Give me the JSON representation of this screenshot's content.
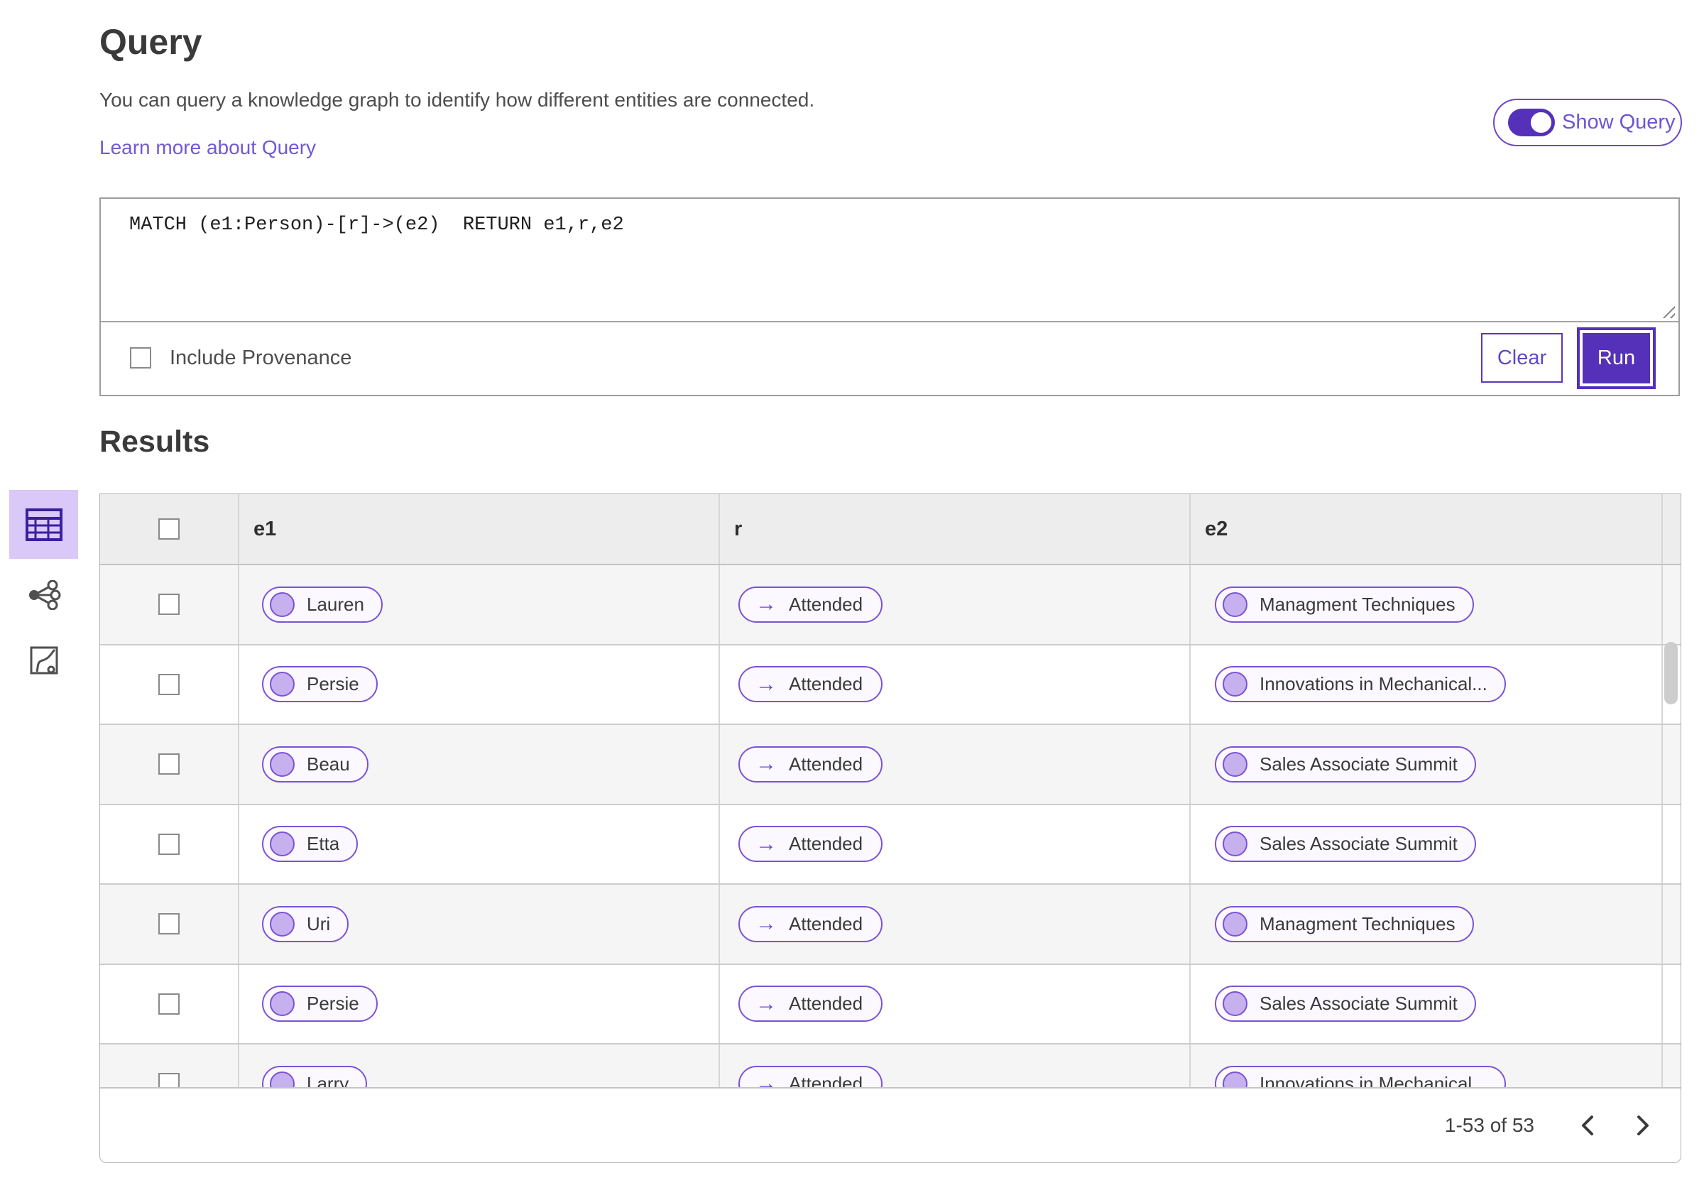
{
  "page": {
    "title": "Query",
    "description": "You can query a knowledge graph to identify how different entities are connected.",
    "learn_more_link": "Learn more about Query"
  },
  "show_query_toggle": {
    "label": "Show Query",
    "state": "on"
  },
  "query_editor": {
    "query_text": "MATCH (e1:Person)-[r]->(e2)  RETURN e1,r,e2",
    "include_provenance_label": "Include Provenance",
    "include_provenance_checked": false,
    "clear_label": "Clear",
    "run_label": "Run"
  },
  "results": {
    "title": "Results",
    "columns": {
      "e1": "e1",
      "r": "r",
      "e2": "e2"
    },
    "rows": [
      {
        "e1": "Lauren",
        "r": "Attended",
        "e2": "Managment Techniques"
      },
      {
        "e1": "Persie",
        "r": "Attended",
        "e2": "Innovations in Mechanical..."
      },
      {
        "e1": "Beau",
        "r": "Attended",
        "e2": "Sales Associate Summit"
      },
      {
        "e1": "Etta",
        "r": "Attended",
        "e2": "Sales Associate Summit"
      },
      {
        "e1": "Uri",
        "r": "Attended",
        "e2": "Managment Techniques"
      },
      {
        "e1": "Persie",
        "r": "Attended",
        "e2": "Sales Associate Summit"
      },
      {
        "e1": "Larry",
        "r": "Attended",
        "e2": "Innovations in Mechanical..."
      }
    ],
    "pagination": {
      "range_label": "1-53 of 53"
    }
  },
  "sidebar": {
    "items": [
      {
        "name": "table-view",
        "icon": "table-icon",
        "selected": true
      },
      {
        "name": "graph-view",
        "icon": "network-graph-icon",
        "selected": false
      },
      {
        "name": "map-view",
        "icon": "route-chart-icon",
        "selected": false
      }
    ]
  },
  "icons": {
    "relationship_arrow": "→",
    "chevron_left": "chevron-left-icon",
    "chevron_right": "chevron-right-icon"
  },
  "colors": {
    "primary_purple": "#5431b8",
    "chip_border_purple": "#7a53d6",
    "chip_dot_fill": "#c6b0ee",
    "link_purple": "#7258d6",
    "selected_view_bg": "#d9c8f8",
    "header_row_bg": "#ededed",
    "alt_row_bg": "#f5f5f5"
  }
}
